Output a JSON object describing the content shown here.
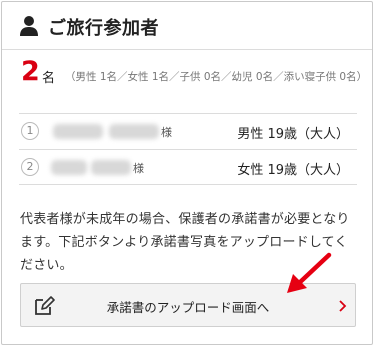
{
  "header": {
    "title": "ご旅行参加者",
    "icon": "person-icon"
  },
  "summary": {
    "count": "2",
    "unit": "名",
    "breakdown": "（男性 1名／女性 1名／子供 0名／幼児 0名／添い寝子供 0名）"
  },
  "travelers": [
    {
      "index": "1",
      "honorific": "様",
      "detail": "男性 19歳（大人）"
    },
    {
      "index": "2",
      "honorific": "様",
      "detail": "女性 19歳（大人）"
    }
  ],
  "notice": "代表者様が未成年の場合、保護者の承諾書が必要となります。下記ボタンより承諾書写真をアップロードしてください。",
  "upload_button": {
    "label": "承諾書のアップロード画面へ",
    "icon": "edit-document-icon",
    "chevron": "chevron-right-icon"
  },
  "colors": {
    "accent": "#d90012",
    "border": "#c9c9c9",
    "button_bg": "#f3f3f3"
  }
}
